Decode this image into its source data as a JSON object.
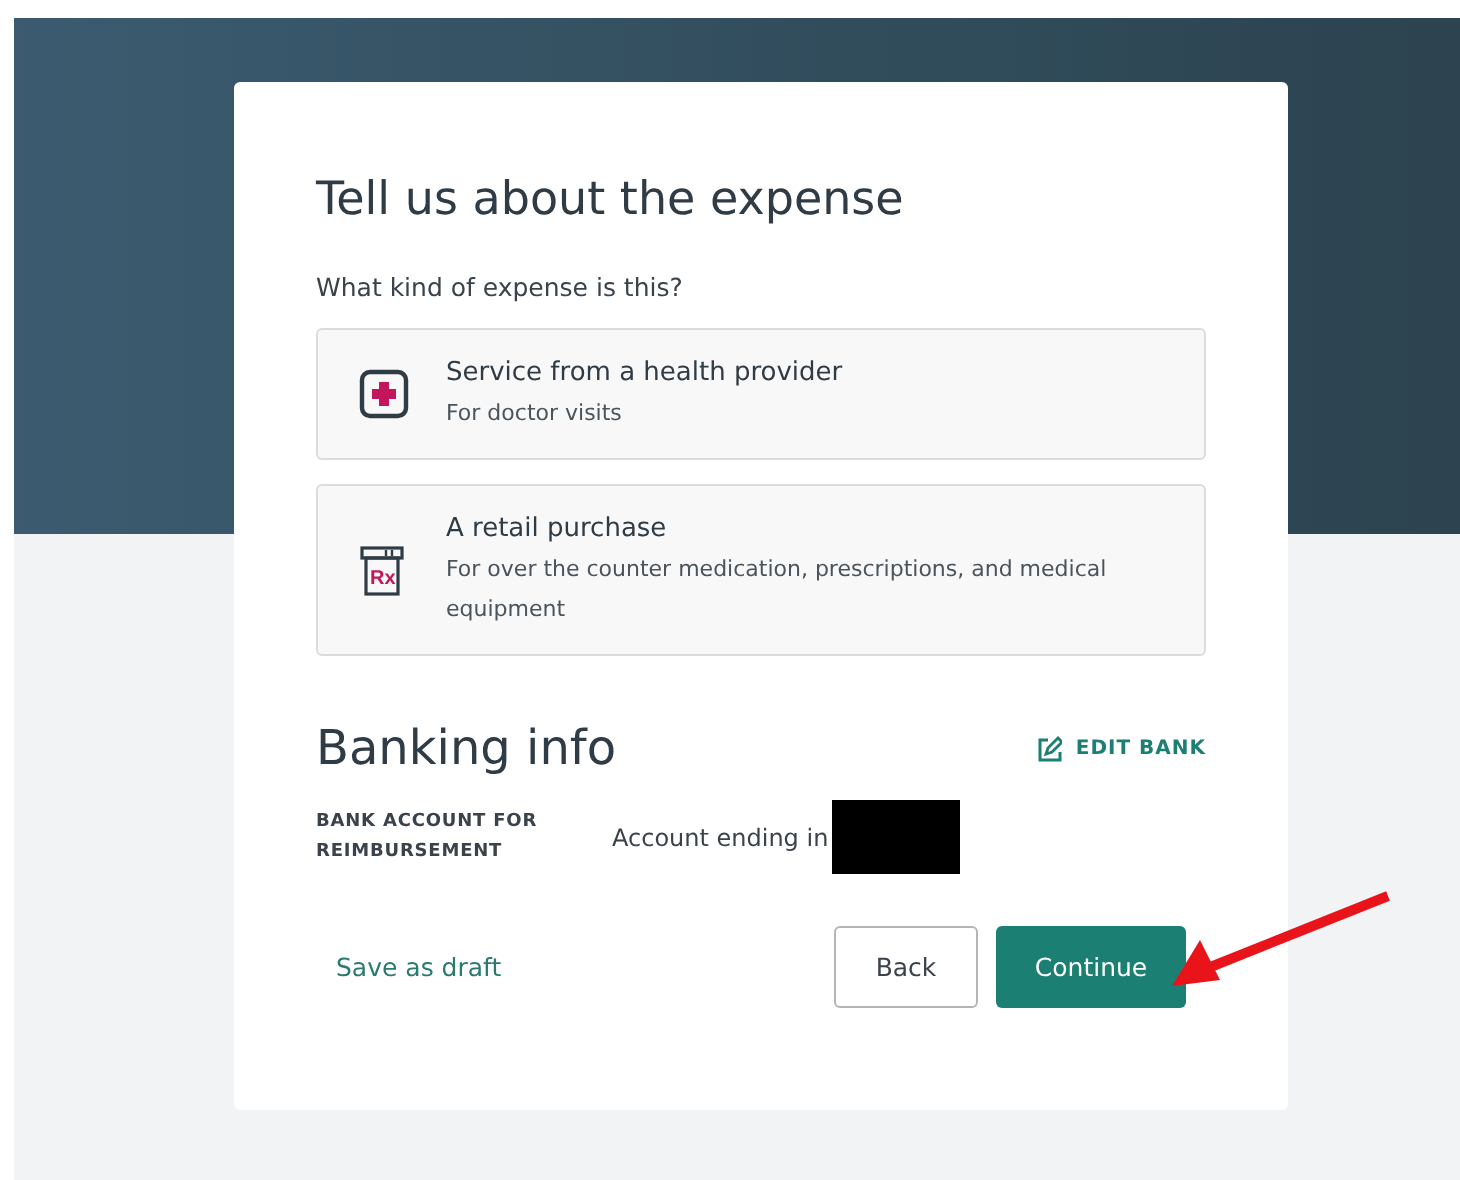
{
  "expense": {
    "heading": "Tell us about the expense",
    "question": "What kind of expense is this?",
    "options": [
      {
        "kind": "health",
        "title": "Service from a health provider",
        "description": "For doctor visits"
      },
      {
        "kind": "rx",
        "icon_text": "Rx",
        "title": "A retail purchase",
        "description": "For over the counter medication, prescriptions, and medical equipment"
      }
    ]
  },
  "banking": {
    "heading": "Banking info",
    "edit_link": "EDIT BANK",
    "account_label": "BANK ACCOUNT FOR REIMBURSEMENT",
    "account_value": "Account ending in",
    "redacted": true
  },
  "actions": {
    "save_draft": "Save as draft",
    "back": "Back",
    "continue": "Continue"
  },
  "annotations": [
    {
      "kind": "arrow",
      "color": "#e8141a"
    }
  ]
}
